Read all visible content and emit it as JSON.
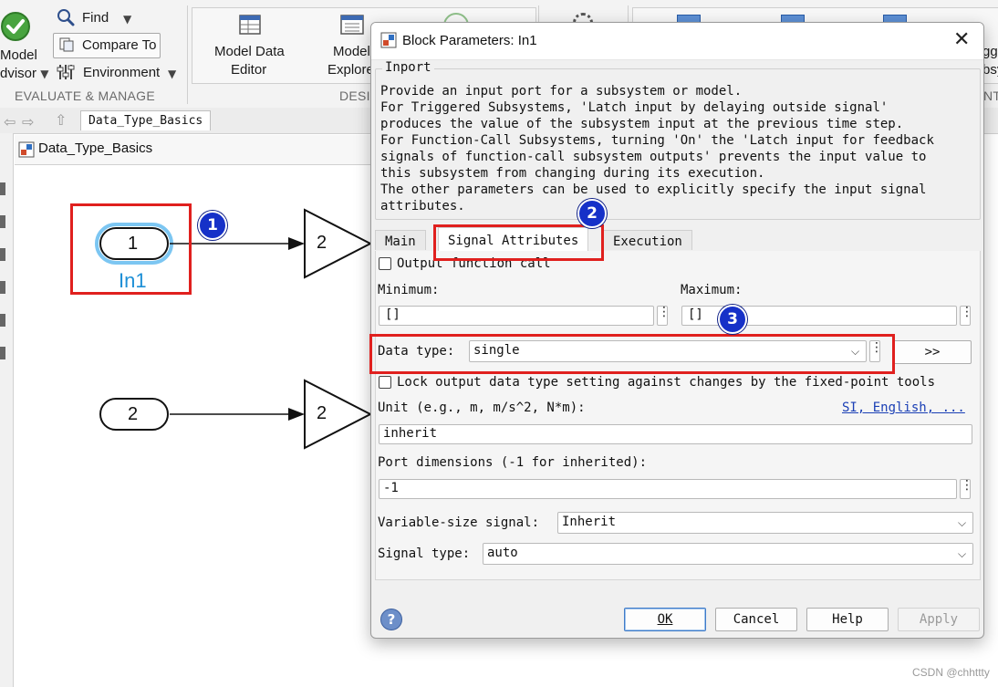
{
  "toolstrip": {
    "model_advisor": [
      "Model",
      "dvisor"
    ],
    "find": "Find",
    "compare_to": "Compare To",
    "environment": "Environment",
    "evaluate_manage": "EVALUATE & MANAGE",
    "model_data_editor": [
      "Model Data",
      "Editor"
    ],
    "model_explorer": [
      "Model",
      "Explore"
    ],
    "design_label": "DESIG",
    "right_partial_1": "gg",
    "right_partial_2": "bsy",
    "right_section_partial": "NT"
  },
  "tabs": {
    "model_tab": "Data_Type_Basics"
  },
  "address_bar": {
    "path": "Data_Type_Basics"
  },
  "canvas": {
    "inport1_number": "1",
    "inport1_label": "In1",
    "inport2_number": "2",
    "gain1_value": "2",
    "gain2_value": "2"
  },
  "dialog": {
    "title": "Block Parameters: In1",
    "group_label": "Inport",
    "description": [
      "Provide an input port for a subsystem or model.",
      "For Triggered Subsystems, 'Latch input by delaying outside signal'",
      "produces the value of the subsystem input at the previous time step.",
      "For Function-Call Subsystems, turning 'On' the 'Latch input for feedback",
      "signals of function-call subsystem outputs' prevents the input value to",
      "this subsystem from changing during its execution.",
      "The other parameters can be used to explicitly specify the input signal",
      "attributes."
    ],
    "tabs": [
      "Main",
      "Signal Attributes",
      "Execution"
    ],
    "output_function_call": "Output function call",
    "minimum_label": "Minimum:",
    "minimum_value": "[]",
    "maximum_label": "Maximum:",
    "maximum_value": "[]",
    "data_type_label": "Data type:",
    "data_type_value": "single",
    "data_type_assistant": ">>",
    "lock_label": "Lock output data type setting against changes by the fixed-point tools",
    "unit_label": "Unit (e.g., m, m/s^2, N*m):",
    "unit_link": "SI, English, ...",
    "unit_value": "inherit",
    "port_dim_label": "Port dimensions (-1 for inherited):",
    "port_dim_value": "-1",
    "var_size_label": "Variable-size signal:",
    "var_size_value": "Inherit",
    "signal_type_label": "Signal type:",
    "signal_type_value": "auto",
    "buttons": {
      "ok": "OK",
      "cancel": "Cancel",
      "help": "Help",
      "apply": "Apply",
      "help_icon": "?"
    }
  },
  "annotations": {
    "badge1": "1",
    "badge2": "2",
    "badge3": "3"
  },
  "watermark": "CSDN @chhttty",
  "colors": {
    "annotation_red": "#e0201e",
    "badge_blue": "#1631c8",
    "inport_label_blue": "#1d8fd6",
    "link_blue": "#1a3fb5"
  }
}
